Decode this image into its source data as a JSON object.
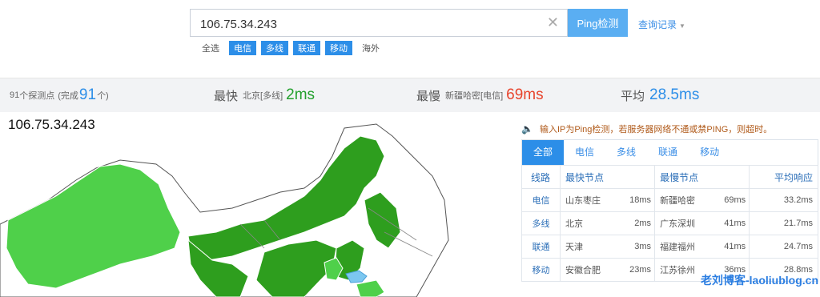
{
  "search": {
    "value": "106.75.34.243",
    "ping_button": "Ping检测",
    "history_link": "查询记录"
  },
  "filters": [
    {
      "label": "全选",
      "selected": false
    },
    {
      "label": "电信",
      "selected": true
    },
    {
      "label": "多线",
      "selected": true
    },
    {
      "label": "联通",
      "selected": true
    },
    {
      "label": "移动",
      "selected": true
    },
    {
      "label": "海外",
      "selected": false
    }
  ],
  "stats": {
    "probe_count": "91",
    "probe_label": "个探测点",
    "done_prefix": "(完成",
    "done_count": "91",
    "done_suffix": "个)",
    "fastest_label": "最快",
    "fastest_node": "北京[多线]",
    "fastest_value": "2ms",
    "slowest_label": "最慢",
    "slowest_node": "新疆哈密[电信]",
    "slowest_value": "69ms",
    "avg_label": "平均",
    "avg_value": "28.5ms"
  },
  "map_title": "106.75.34.243",
  "notice": "输入IP为Ping检测，若服务器网络不通或禁PING，则超时。",
  "tabs": [
    "全部",
    "电信",
    "多线",
    "联通",
    "移动"
  ],
  "table": {
    "headers": [
      "线路",
      "最快节点",
      "最慢节点",
      "平均响应"
    ],
    "rows": [
      {
        "line": "电信",
        "fast_node": "山东枣庄",
        "fast_ms": "18ms",
        "slow_node": "新疆哈密",
        "slow_ms": "69ms",
        "avg": "33.2ms"
      },
      {
        "line": "多线",
        "fast_node": "北京",
        "fast_ms": "2ms",
        "slow_node": "广东深圳",
        "slow_ms": "41ms",
        "avg": "21.7ms"
      },
      {
        "line": "联通",
        "fast_node": "天津",
        "fast_ms": "3ms",
        "slow_node": "福建福州",
        "slow_ms": "41ms",
        "avg": "24.7ms"
      },
      {
        "line": "移动",
        "fast_node": "安徽合肥",
        "fast_ms": "23ms",
        "slow_node": "江苏徐州",
        "slow_ms": "36ms",
        "avg": "28.8ms"
      }
    ]
  },
  "watermark": "老刘博客-laoliublog.cn",
  "colors": {
    "accent": "#2c8ee8",
    "map_light_green": "#4fd04a",
    "map_dark_green": "#2e9e1e",
    "fast": "#22a02c",
    "slow": "#e8442c"
  }
}
